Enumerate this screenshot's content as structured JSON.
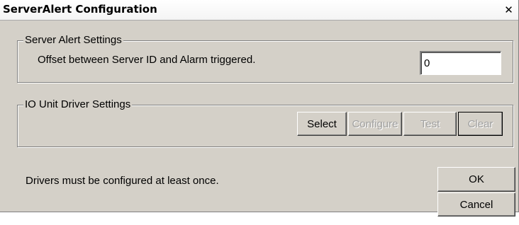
{
  "window": {
    "title": "ServerAlert Configuration",
    "close_glyph": "✕"
  },
  "server_alert_settings": {
    "legend": "Server Alert Settings",
    "offset_label": "Offset between Server ID and Alarm triggered.",
    "offset_value": "0"
  },
  "io_unit_driver_settings": {
    "legend": "IO Unit Driver Settings",
    "buttons": [
      {
        "label": "Select",
        "enabled": true
      },
      {
        "label": "Configure",
        "enabled": false
      },
      {
        "label": "Test",
        "enabled": false
      },
      {
        "label": "Clear",
        "enabled": false
      }
    ]
  },
  "footer": {
    "message": "Drivers must be configured at least once.",
    "ok_label": "OK",
    "cancel_label": "Cancel"
  },
  "colors": {
    "dialog_bg": "#d4d0c8",
    "disabled_text": "#a0a0a0"
  },
  "icons": {
    "close": "close-icon"
  }
}
